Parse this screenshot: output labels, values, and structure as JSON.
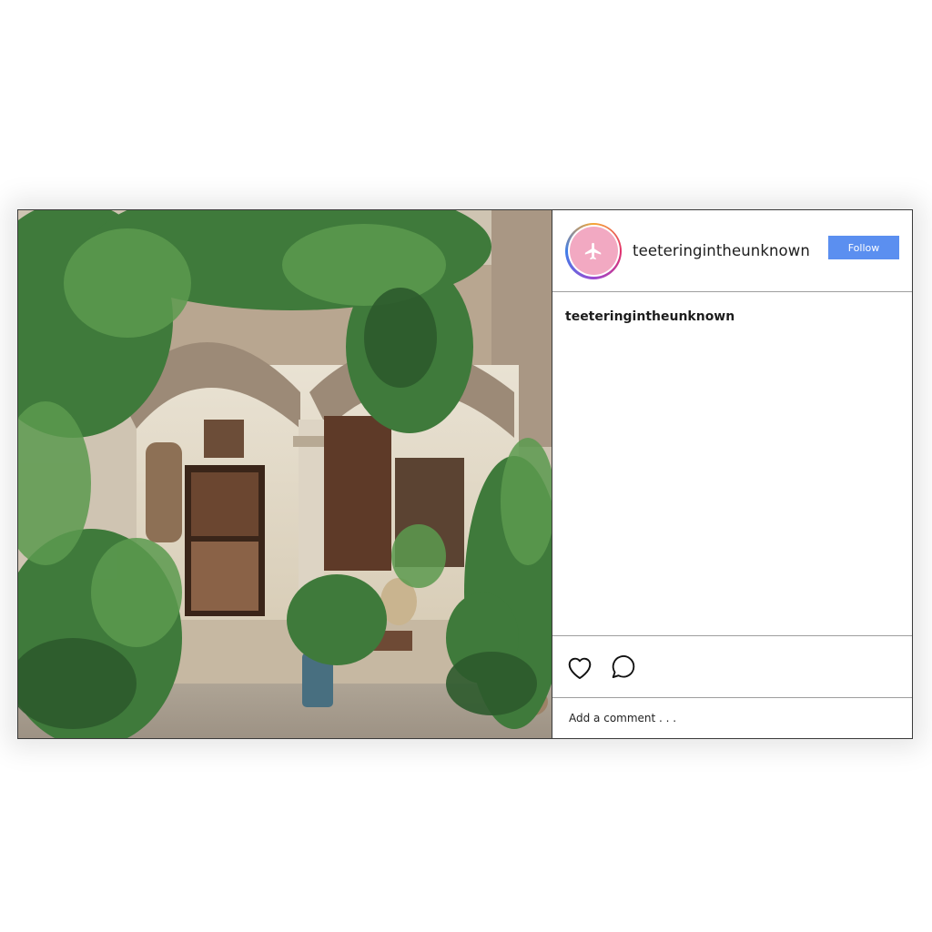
{
  "post": {
    "username": "teeteringintheunknown",
    "follow_label": "Follow",
    "caption_username": "teeteringintheunknown",
    "comment_placeholder": "Add a comment . . ."
  },
  "icons": {
    "avatar": "airplane-icon",
    "like": "heart-icon",
    "comment": "speech-bubble-icon"
  },
  "colors": {
    "follow_button": "#5b8ff0",
    "avatar_bg": "#f2a9c2"
  }
}
